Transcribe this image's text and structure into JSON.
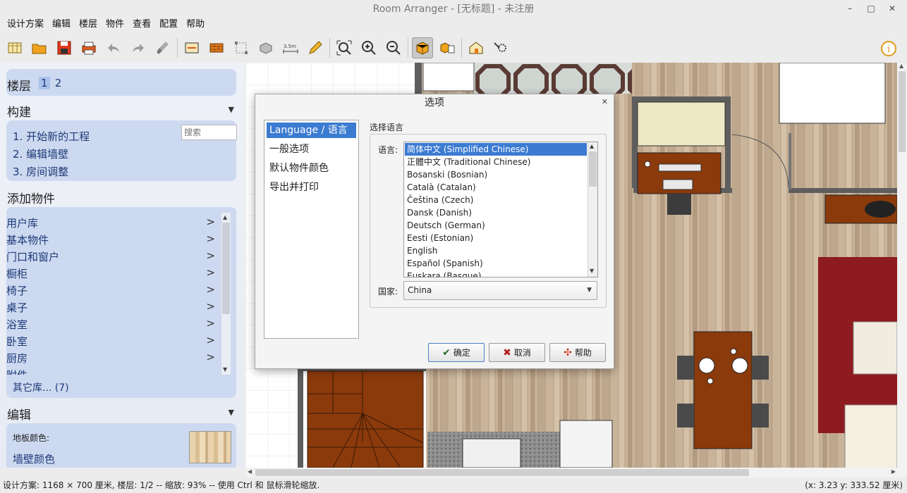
{
  "window": {
    "title": "Room Arranger - [无标题] - 未注册",
    "controls": [
      "–",
      "□",
      "✕"
    ]
  },
  "menu": [
    "设计方案",
    "编辑",
    "楼层",
    "物件",
    "查看",
    "配置",
    "帮助"
  ],
  "toolbar": {
    "scale_label": "3.5m"
  },
  "left": {
    "floors_label": "楼层",
    "floors": [
      "1",
      "2"
    ],
    "build_label": "构建",
    "build_items": [
      "1. 开始新的工程",
      "2. 编辑墙壁",
      "3. 房间调整"
    ],
    "add_label": "添加物件",
    "search_placeholder": "搜索",
    "library": [
      "用户库",
      "基本物件",
      "门口和窗户",
      "橱柜",
      "椅子",
      "桌子",
      "浴室",
      "卧室",
      "厨房",
      "附件"
    ],
    "more_libs": "其它库... (7)",
    "edit_label": "编辑",
    "floor_color_label": "地板颜色:",
    "wall_color_label": "墙壁颜色"
  },
  "dialog": {
    "title": "选项",
    "nav": [
      "Language / 语言",
      "一般选项",
      "默认物件颜色",
      "导出并打印"
    ],
    "group_title": "选择语言",
    "lang_label": "语言:",
    "languages": [
      "简体中文 (Simplified Chinese)",
      "正體中文 (Traditional Chinese)",
      "Bosanski (Bosnian)",
      "Català (Catalan)",
      "Čeština (Czech)",
      "Dansk (Danish)",
      "Deutsch (German)",
      "Eesti (Estonian)",
      "English",
      "Español (Spanish)",
      "Euskara (Basque)"
    ],
    "selected_language": "简体中文 (Simplified Chinese)",
    "country_label": "国家:",
    "country_value": "China",
    "ok": "确定",
    "cancel": "取消",
    "help": "帮助"
  },
  "status": {
    "text": "设计方案: 1168 × 700 厘米, 楼层: 1/2 -- 缩放: 93% -- 使用 Ctrl 和 鼠标滑轮缩放.",
    "coords": "(x: 3.23 y: 333.52 厘米)"
  },
  "colors": {
    "accent": "#3b7bd1",
    "panel_box": "#cdd9f0",
    "link": "#1e3a78",
    "floor_wood": "#c9b49a",
    "wall": "#5a5a5a",
    "furniture": "#8b3a0c",
    "rug": "#8e1b1f"
  }
}
